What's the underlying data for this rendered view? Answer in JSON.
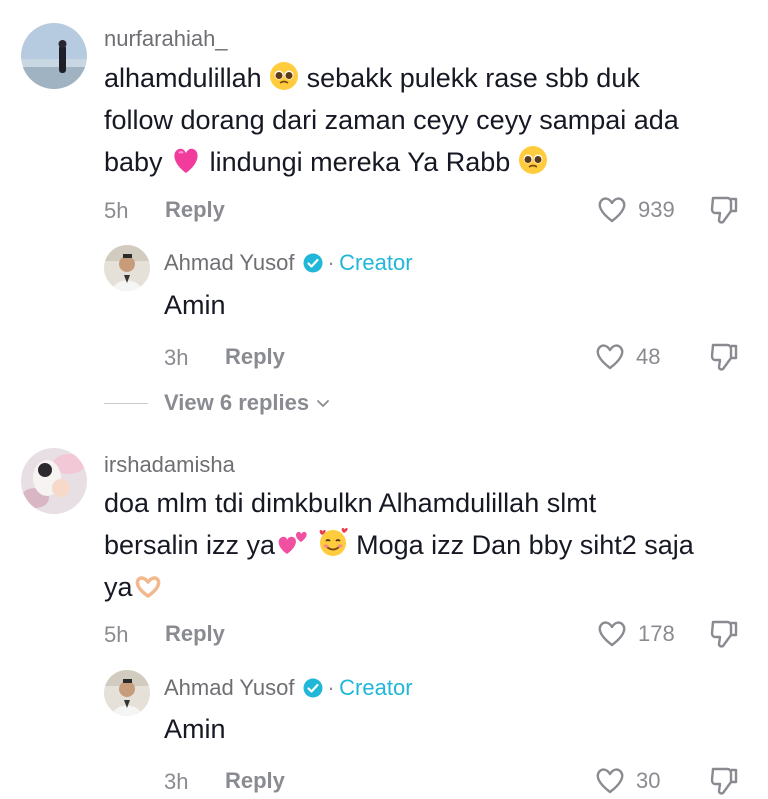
{
  "comments": [
    {
      "username": "nurfarahiah_",
      "text_parts": [
        "alhamdulillah",
        "sebakk pulekk rase sbb duk",
        "follow dorang dari zaman ceyy ceyy sampai ada",
        "baby",
        "lindungi mereka Ya Rabb"
      ],
      "time": "5h",
      "reply_label": "Reply",
      "likes": "939",
      "icons": [
        "pleading-face-emoji",
        "pink-heart-emoji",
        "heart-outline-icon",
        "thumbs-down-icon"
      ],
      "reply": {
        "username": "Ahmad Yusof",
        "badge": "Creator",
        "separator": "·",
        "text": "Amin",
        "time": "3h",
        "reply_label": "Reply",
        "likes": "48"
      },
      "view_replies": "View 6 replies"
    },
    {
      "username": "irshadamisha",
      "text_parts": [
        "doa mlm tdi dimkbulkn Alhamdulillah slmt",
        "bersalin izz ya",
        "Moga izz Dan bby siht2 saja",
        "ya"
      ],
      "time": "5h",
      "reply_label": "Reply",
      "likes": "178",
      "reply": {
        "username": "Ahmad Yusof",
        "badge": "Creator",
        "separator": "·",
        "text": "Amin",
        "time": "3h",
        "reply_label": "Reply",
        "likes": "30"
      }
    }
  ],
  "colors": {
    "creator": "#20b7d8",
    "verified": "#20b7d8",
    "muted": "#8a8b91"
  }
}
